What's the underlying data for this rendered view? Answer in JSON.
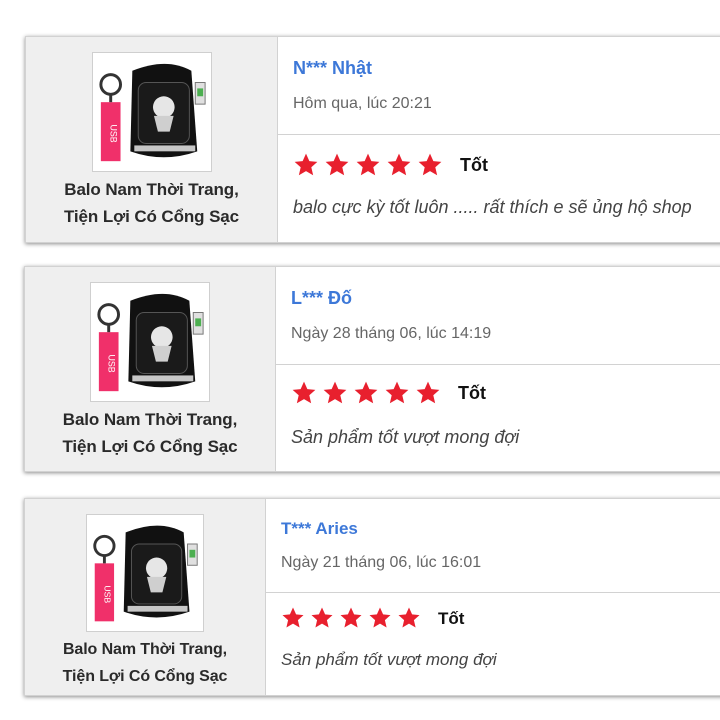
{
  "colors": {
    "star": "#e8202e",
    "user": "#3d78d8",
    "card_left_bg": "#efefef"
  },
  "reviews": [
    {
      "product_name_line1": "Balo Nam Thời Trang,",
      "product_name_line2": "Tiện Lợi Có Cổng Sạc",
      "thumb_badge": "USB",
      "user": "N*** Nhật",
      "date": "Hôm qua, lúc 20:21",
      "stars": 5,
      "rating_label": "Tốt",
      "comment": "balo cực kỳ tốt luôn ..... rất thích e sẽ ủng hộ shop"
    },
    {
      "product_name_line1": "Balo Nam Thời Trang,",
      "product_name_line2": "Tiện Lợi Có Cổng Sạc",
      "thumb_badge": "USB",
      "user": "L*** Đố",
      "date": "Ngày 28 tháng 06, lúc 14:19",
      "stars": 5,
      "rating_label": "Tốt",
      "comment": "Sản phẩm tốt vượt mong đợi"
    },
    {
      "product_name_line1": "Balo Nam Thời Trang,",
      "product_name_line2": "Tiện Lợi Có Cổng Sạc",
      "thumb_badge": "USB",
      "user": "T*** Aries",
      "date": "Ngày 21 tháng 06, lúc 16:01",
      "stars": 5,
      "rating_label": "Tốt",
      "comment": "Sản phẩm tốt vượt mong đợi"
    }
  ]
}
